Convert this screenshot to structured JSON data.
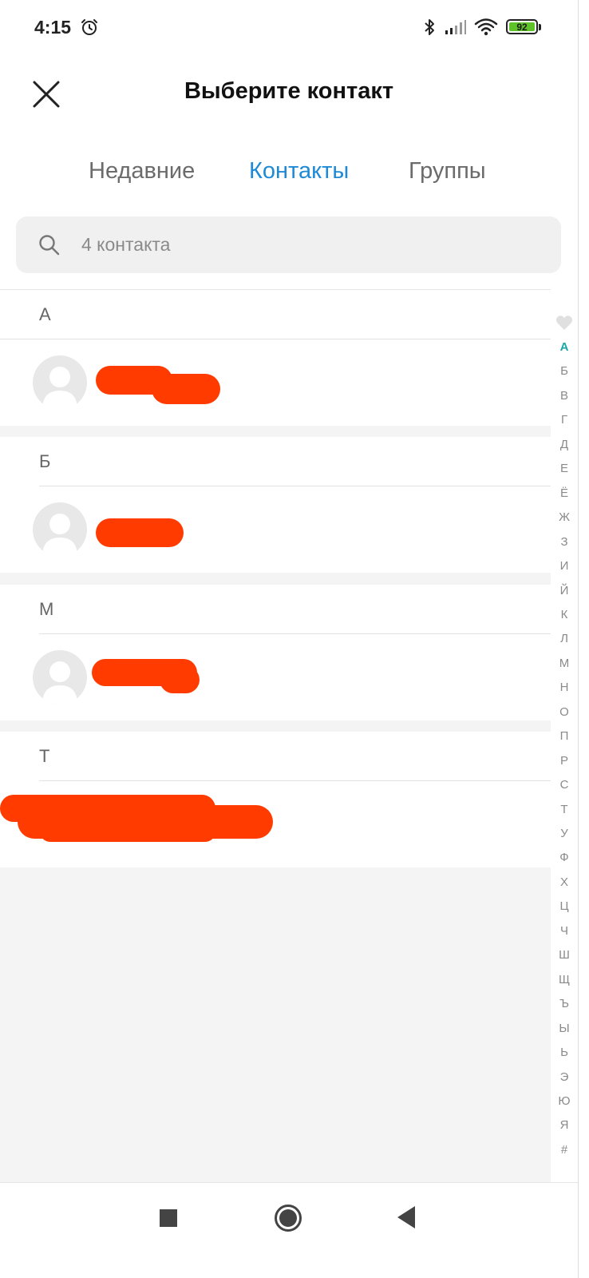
{
  "status_bar": {
    "time": "4:15",
    "battery": "92"
  },
  "header": {
    "title": "Выберите контакт"
  },
  "tabs": [
    {
      "label": "Недавние",
      "active": false
    },
    {
      "label": "Контакты",
      "active": true
    },
    {
      "label": "Группы",
      "active": false
    }
  ],
  "search": {
    "placeholder": "4 контакта"
  },
  "sections": [
    {
      "letter": "А"
    },
    {
      "letter": "Б"
    },
    {
      "letter": "М"
    },
    {
      "letter": "Т"
    }
  ],
  "alphabet_index": [
    "А",
    "Б",
    "В",
    "Г",
    "Д",
    "Е",
    "Ё",
    "Ж",
    "З",
    "И",
    "Й",
    "К",
    "Л",
    "М",
    "Н",
    "О",
    "П",
    "Р",
    "С",
    "Т",
    "У",
    "Ф",
    "Х",
    "Ц",
    "Ч",
    "Ш",
    "Щ",
    "Ъ",
    "Ы",
    "Ь",
    "Э",
    "Ю",
    "Я",
    "#"
  ],
  "colors": {
    "accent": "#1e8ad6",
    "index_active": "#1aa6a6",
    "redaction": "#ff3b00",
    "battery": "#5fc22b"
  },
  "icons": {
    "status": [
      "alarm-icon",
      "bluetooth-icon",
      "signal-icon",
      "wifi-icon",
      "battery-icon"
    ],
    "header": "close-icon",
    "search": "search-icon",
    "index_top": "heart-icon",
    "nav": [
      "recent-apps-icon",
      "home-icon",
      "back-icon"
    ]
  }
}
